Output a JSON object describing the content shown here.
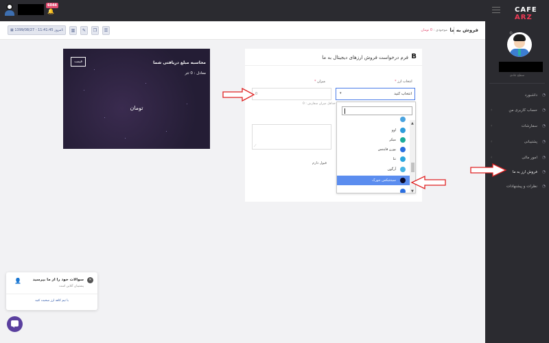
{
  "topbar": {
    "notification_count": "6044",
    "logo_prefix": "CAFE",
    "logo_suffix": "ARZ"
  },
  "sidebar": {
    "user_label": "سطح عادی",
    "items": [
      {
        "label": "داشبورد",
        "icon": "home-icon",
        "has_children": false
      },
      {
        "label": "حساب کاربری من",
        "icon": "user-icon",
        "has_children": true
      },
      {
        "label": "سفارشات",
        "icon": "cart-icon",
        "has_children": true
      },
      {
        "label": "پشتیبانی",
        "icon": "support-icon",
        "has_children": true
      },
      {
        "label": "امور مالی",
        "icon": "wallet-icon",
        "has_children": true
      },
      {
        "label": "فروش ارز به ما",
        "icon": "exchange-icon",
        "has_children": false
      },
      {
        "label": "نظرات و پیشنهادات",
        "icon": "comment-icon",
        "has_children": false
      }
    ],
    "active_index": 5
  },
  "header": {
    "page_title": "فروش به ما",
    "balance_label": "موجودی :",
    "balance_value": "0 تومان",
    "date_label": "امروز:",
    "date_value": "1399/08/27 - 11:41:45",
    "tools": [
      "chart-icon",
      "edit-icon",
      "copy-icon",
      "list-icon"
    ]
  },
  "promo": {
    "title": "محاسبه مبلغ دریافتی شما",
    "equivalent": "معادل : 0 تتر",
    "price_button": "قیمت",
    "amount": "تومان"
  },
  "form": {
    "title": "فرم درخواست فروش ارزهای دیجیتال به ما",
    "currency_label": "انتخاب ارز",
    "currency_placeholder": "انتخاب کنید",
    "amount_label": "میزان",
    "amount_value": "0",
    "amount_hint": "حداقل میزان سفارش : 0",
    "checkbox_label": "قبول دارم"
  },
  "dropdown": {
    "items": [
      {
        "label": "",
        "color": "#4aa3df"
      },
      {
        "label": "اوو",
        "color": "#2d9cdb"
      },
      {
        "label": "میکر",
        "color": "#1aab9b"
      },
      {
        "label": "یورن فایننس",
        "color": "#2a6ee0"
      },
      {
        "label": "تتا",
        "color": "#2aa6de"
      },
      {
        "label": "آرگون",
        "color": "#46b5e5"
      },
      {
        "label": "سینتتیکس نتورک",
        "color": "#0b0b2b"
      },
      {
        "label": "",
        "color": "#2a6ee0"
      }
    ],
    "selected_index": 6
  },
  "chat": {
    "question": "سوالات خود را از ما بپرسید",
    "status": "پشتیبان آنلاین است",
    "link": "با تیم کافه ارز صحبت کنید"
  },
  "colors": {
    "annotation_arrow": "#e02020",
    "accent": "#e24a6f",
    "sidebar_bg": "#2b2b30",
    "selection": "#5b8def"
  }
}
